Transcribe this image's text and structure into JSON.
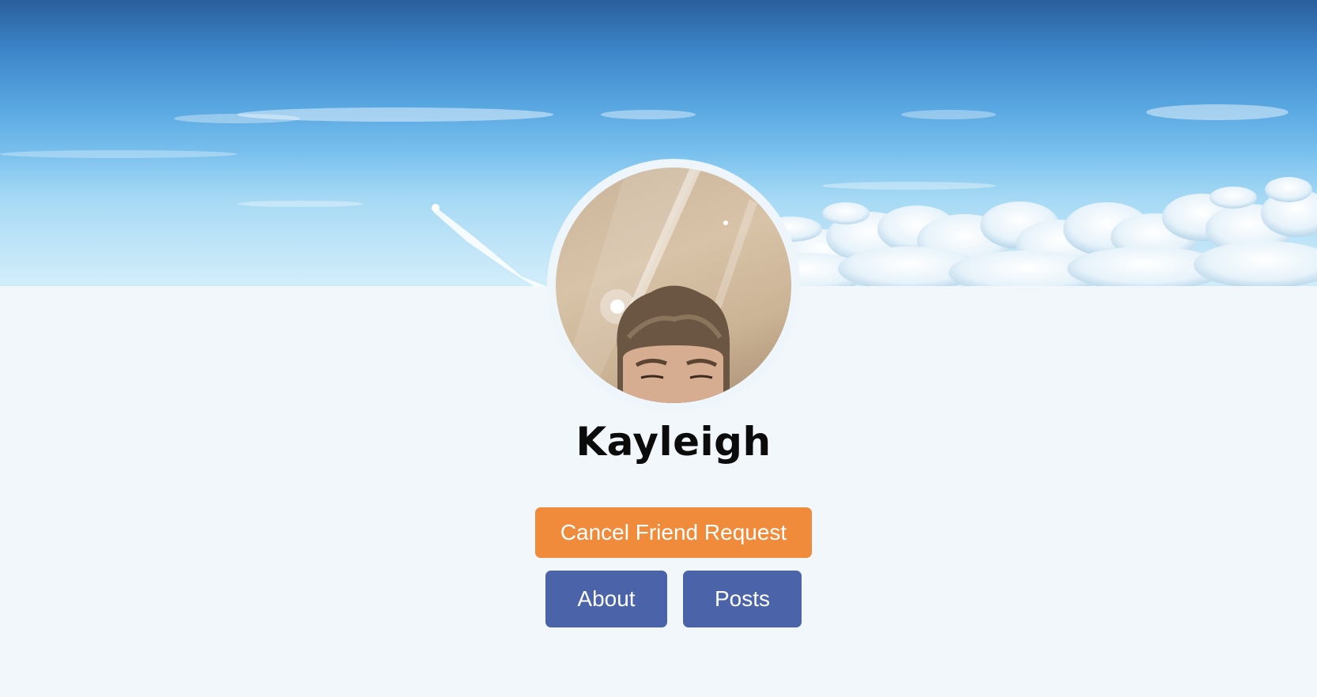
{
  "profile": {
    "name": "Kayleigh",
    "cover_image": "sky-above-clouds-cover",
    "avatar_image": "profile-photo"
  },
  "actions": {
    "cancel_friend_request_label": "Cancel Friend Request",
    "about_label": "About",
    "posts_label": "Posts"
  },
  "colors": {
    "page_background": "#f1f7fb",
    "cancel_button": "#ef8b3a",
    "nav_button": "#4b63a9",
    "button_text": "#ffffff",
    "name_text": "#0b0b0b"
  }
}
